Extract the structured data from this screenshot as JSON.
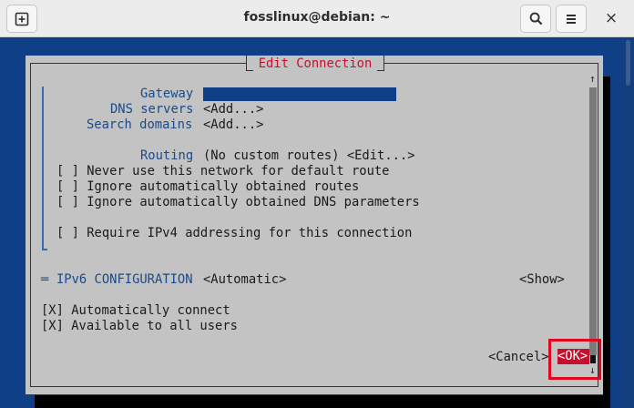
{
  "window": {
    "title": "fosslinux@debian: ~",
    "new_tab_icon": "new-tab-icon",
    "search_icon": "search-icon",
    "menu_icon": "hamburger-menu-icon",
    "close_glyph": "×"
  },
  "dialog": {
    "title": "Edit Connection",
    "fields": {
      "gateway_label": "Gateway",
      "gateway_value": "",
      "dns_label": "DNS servers",
      "dns_value": "<Add...>",
      "search_label": "Search domains",
      "search_value": "<Add...>",
      "routing_label": "Routing",
      "routing_value": "(No custom routes) <Edit...>"
    },
    "checkboxes": [
      "[ ] Never use this network for default route",
      "[ ] Ignore automatically obtained routes",
      "[ ] Ignore automatically obtained DNS parameters",
      "[ ] Require IPv4 addressing for this connection"
    ],
    "ipv6": {
      "marker": "═",
      "label": "IPv6 CONFIGURATION",
      "value": "<Automatic>",
      "show": "<Show>"
    },
    "connection_options": [
      "[X] Automatically connect",
      "[X] Available to all users"
    ],
    "cancel_label": "<Cancel>",
    "ok_label": "<OK>",
    "scroll_up": "↑",
    "scroll_down": "↓"
  },
  "colors": {
    "terminal_bg": "#0f3f86",
    "dialog_bg": "#c3c3c3",
    "title_red": "#c8102e",
    "highlight_red": "#e0061f",
    "label_blue": "#1a4a8a"
  }
}
